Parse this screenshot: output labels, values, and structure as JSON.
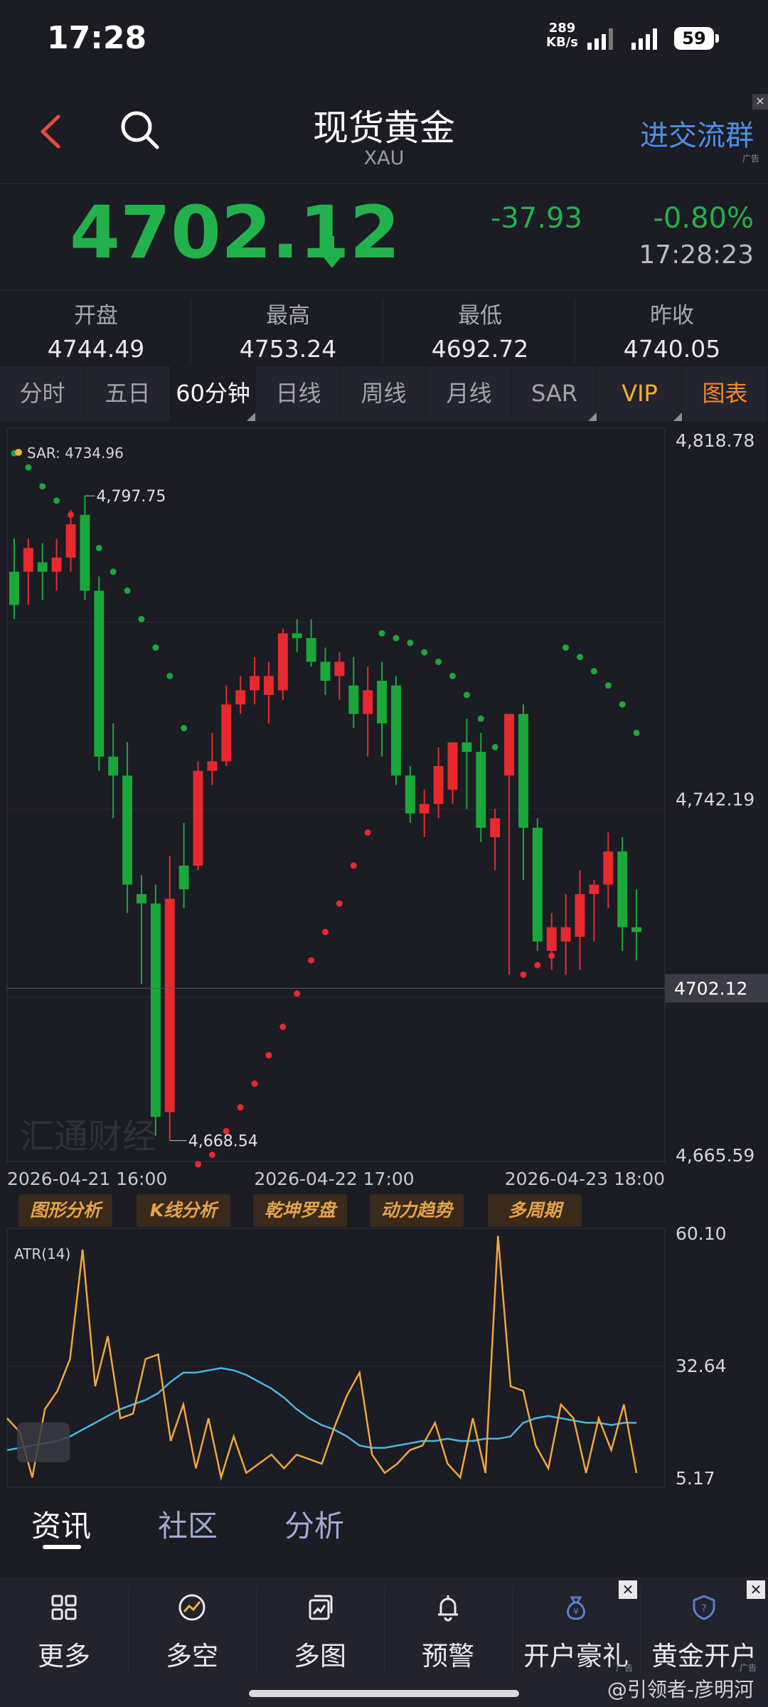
{
  "status_bar": {
    "time": "17:28",
    "net_speed": "289",
    "net_unit": "KB/s",
    "battery": "59"
  },
  "header": {
    "title": "现货黄金",
    "subtitle": "XAU",
    "promo": "进交流群",
    "promo_ad": "广告"
  },
  "quote": {
    "price": "4702.12",
    "change": "-37.93",
    "change_pct": "-0.80%",
    "time": "17:28:23"
  },
  "stats": [
    {
      "label": "开盘",
      "value": "4744.49"
    },
    {
      "label": "最高",
      "value": "4753.24"
    },
    {
      "label": "最低",
      "value": "4692.72"
    },
    {
      "label": "昨收",
      "value": "4740.05"
    }
  ],
  "tabs": [
    "分时",
    "五日",
    "60分钟",
    "日线",
    "周线",
    "月线",
    "SAR",
    "VIP",
    "图表"
  ],
  "colors": {
    "up": "#e8292e",
    "down": "#1aa83a",
    "accent": "#f0b030",
    "link": "#4f8fe0"
  },
  "chart_data": [
    {
      "type": "candlestick",
      "indicator_label": "SAR: 4734.96",
      "y_ticks": [
        "4,818.78",
        "4,742.19",
        "4,665.59"
      ],
      "ylim": [
        4665.59,
        4818.78
      ],
      "last_price_label": "4702.12",
      "high_annotation": "4,797.75",
      "low_annotation": "4,668.54",
      "x_ticks": [
        "2026-04-21 16:00",
        "2026-04-22 17:00",
        "2026-04-23 18:00"
      ],
      "candles": [
        [
          4790,
          4797,
          4780,
          4783
        ],
        [
          4790,
          4797,
          4783,
          4795
        ],
        [
          4792,
          4796,
          4784,
          4790
        ],
        [
          4790,
          4797,
          4786,
          4793
        ],
        [
          4793,
          4803,
          4790,
          4800
        ],
        [
          4802,
          4806,
          4784,
          4786
        ],
        [
          4786,
          4789,
          4748,
          4751
        ],
        [
          4751,
          4758,
          4738,
          4747
        ],
        [
          4747,
          4754,
          4718,
          4724
        ],
        [
          4722,
          4726,
          4703,
          4720
        ],
        [
          4720,
          4724,
          4671,
          4675
        ],
        [
          4676,
          4730,
          4670,
          4721
        ],
        [
          4728,
          4737,
          4719,
          4723
        ],
        [
          4728,
          4750,
          4727,
          4748
        ],
        [
          4748,
          4756,
          4745,
          4750
        ],
        [
          4750,
          4766,
          4749,
          4762
        ],
        [
          4762,
          4768,
          4760,
          4765
        ],
        [
          4765,
          4772,
          4762,
          4768
        ],
        [
          4764,
          4771,
          4758,
          4768
        ],
        [
          4765,
          4778,
          4763,
          4777
        ],
        [
          4777,
          4780,
          4773,
          4776
        ],
        [
          4776,
          4780,
          4770,
          4771
        ],
        [
          4771,
          4774,
          4764,
          4767
        ],
        [
          4768,
          4773,
          4763,
          4771
        ],
        [
          4766,
          4772,
          4757,
          4760
        ],
        [
          4760,
          4770,
          4751,
          4765
        ],
        [
          4767,
          4771,
          4751,
          4758
        ],
        [
          4766,
          4768,
          4745,
          4747
        ],
        [
          4747,
          4749,
          4737,
          4739
        ],
        [
          4739,
          4744,
          4734,
          4741
        ],
        [
          4741,
          4753,
          4738,
          4749
        ],
        [
          4744,
          4752,
          4741,
          4754
        ],
        [
          4754,
          4759,
          4740,
          4752
        ],
        [
          4752,
          4756,
          4733,
          4736
        ],
        [
          4734,
          4740,
          4727,
          4738
        ],
        [
          4747,
          4758,
          4705,
          4760
        ],
        [
          4760,
          4762,
          4725,
          4736
        ],
        [
          4736,
          4738,
          4710,
          4712
        ],
        [
          4710,
          4718,
          4706,
          4715
        ],
        [
          4712,
          4722,
          4705,
          4715
        ],
        [
          4713,
          4727,
          4706,
          4722
        ],
        [
          4722,
          4725,
          4712,
          4724
        ],
        [
          4724,
          4735,
          4719,
          4731
        ],
        [
          4731,
          4734,
          4710,
          4715
        ],
        [
          4715,
          4723,
          4708,
          4714
        ]
      ],
      "sar": [
        4815,
        4812,
        4808,
        4805,
        4802,
        4798,
        4795,
        4790,
        4786,
        4780,
        4774,
        4768,
        4757,
        4665,
        4667,
        4672,
        4677,
        4682,
        4688,
        4694,
        4701,
        4708,
        4714,
        4720,
        4728,
        4735,
        4777,
        4776,
        4775,
        4773,
        4771,
        4768,
        4764,
        4759,
        4753,
        4749,
        4705,
        4707,
        4709,
        4774,
        4772,
        4769,
        4766,
        4762,
        4756
      ]
    },
    {
      "type": "line",
      "label": "ATR(14)",
      "y_ticks": [
        "60.10",
        "32.64",
        "5.17"
      ],
      "ylim": [
        5.17,
        60.1
      ],
      "series": [
        {
          "name": "ATR(14)",
          "color": "#4ab8e0",
          "values": [
            13,
            13.5,
            14,
            14.5,
            15,
            16,
            17.5,
            19,
            20.5,
            22,
            23,
            24,
            25.5,
            28,
            30,
            30,
            30.5,
            31,
            30.5,
            29.5,
            28,
            26.5,
            24.5,
            22,
            20,
            18.5,
            17.5,
            16,
            14,
            13.5,
            13.5,
            14,
            14.5,
            15,
            15,
            15.5,
            15,
            15,
            15.5,
            15.5,
            16,
            19,
            20,
            20.5,
            20,
            19.5,
            19,
            19,
            18.5,
            19,
            19
          ]
        },
        {
          "name": "TR",
          "color": "#f2a63a",
          "values": [
            20,
            17,
            7,
            22,
            26,
            33,
            57,
            27,
            38,
            20,
            21,
            33,
            34,
            15,
            23,
            9,
            20,
            7,
            16,
            8,
            10,
            12,
            9,
            12,
            11,
            10,
            18,
            25,
            30,
            12,
            8,
            10,
            13,
            14,
            19,
            10,
            7,
            20,
            8,
            60,
            27,
            26,
            14,
            9,
            23,
            20,
            8,
            20,
            13,
            23,
            8
          ]
        }
      ]
    }
  ],
  "tools": [
    "图形分析",
    "K线分析",
    "乾坤罗盘",
    "动力趋势",
    "多周期"
  ],
  "chart_watermark": "汇通财经",
  "news_tabs": [
    "资讯",
    "社区",
    "分析"
  ],
  "bottom_nav": [
    {
      "label": "更多",
      "icon": "grid-icon"
    },
    {
      "label": "多空",
      "icon": "trend-circle-icon"
    },
    {
      "label": "多图",
      "icon": "multi-chart-icon"
    },
    {
      "label": "预警",
      "icon": "bell-icon"
    },
    {
      "label": "开户豪礼",
      "icon": "money-bag-icon",
      "ad": "广告"
    },
    {
      "label": "黄金开户",
      "icon": "gold-account-icon",
      "ad": "广告"
    }
  ],
  "watermark": "@引领者-彦明河"
}
